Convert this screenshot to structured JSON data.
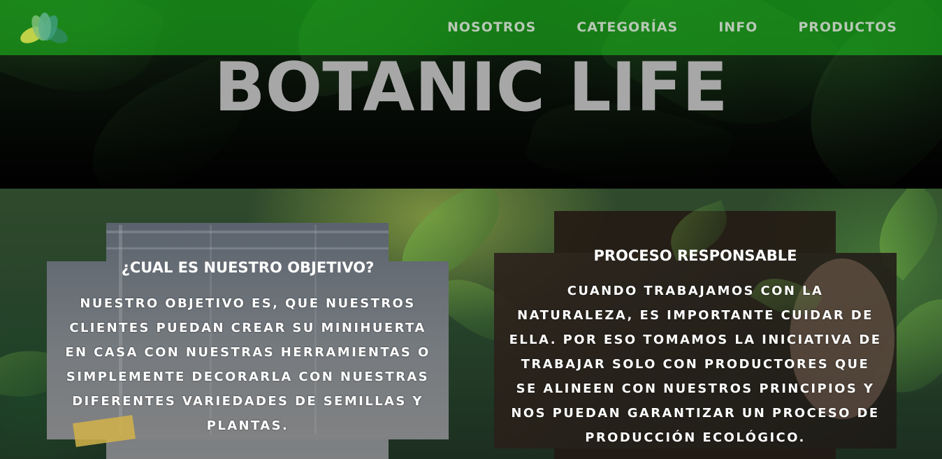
{
  "nav": {
    "links": [
      "NOSOTROS",
      "CATEGORÍAS",
      "INFO",
      "PRODUCTOS"
    ]
  },
  "hero": {
    "title": "BOTANIC LIFE"
  },
  "cards": [
    {
      "title": "¿CUAL ES NUESTRO OBJETIVO?",
      "lines": [
        "NUESTRO OBJETIVO ES, QUE NUESTROS",
        "CLIENTES PUEDAN CREAR SU MINIHUERTA",
        "EN CASA CON NUESTRAS HERRAMIENTAS O",
        "SIMPLEMENTE DECORARLA CON NUESTRAS",
        "DIFERENTES VARIEDADES DE SEMILLAS Y",
        "PLANTAS."
      ]
    },
    {
      "title": "PROCESO RESPONSABLE",
      "lines": [
        "CUANDO TRABAJAMOS CON LA",
        "NATURALEZA, ES IMPORTANTE CUIDAR DE",
        "ELLA. POR ESO TOMAMOS LA INICIATIVA DE",
        "TRABAJAR SOLO CON PRODUCTORES QUE",
        "SE ALINEEN CON NUESTROS PRINCIPIOS Y",
        "NOS PUEDAN GARANTIZAR UN PROCESO DE",
        "PRODUCCIÓN ECOLÓGICO."
      ]
    }
  ],
  "colors": {
    "navbar": "#148c14",
    "nav_text": "#b8c8b6",
    "hero_title": "#a7a7a7",
    "card_text": "#ffffff"
  },
  "icons": {
    "logo": "lotus-logo-icon"
  }
}
